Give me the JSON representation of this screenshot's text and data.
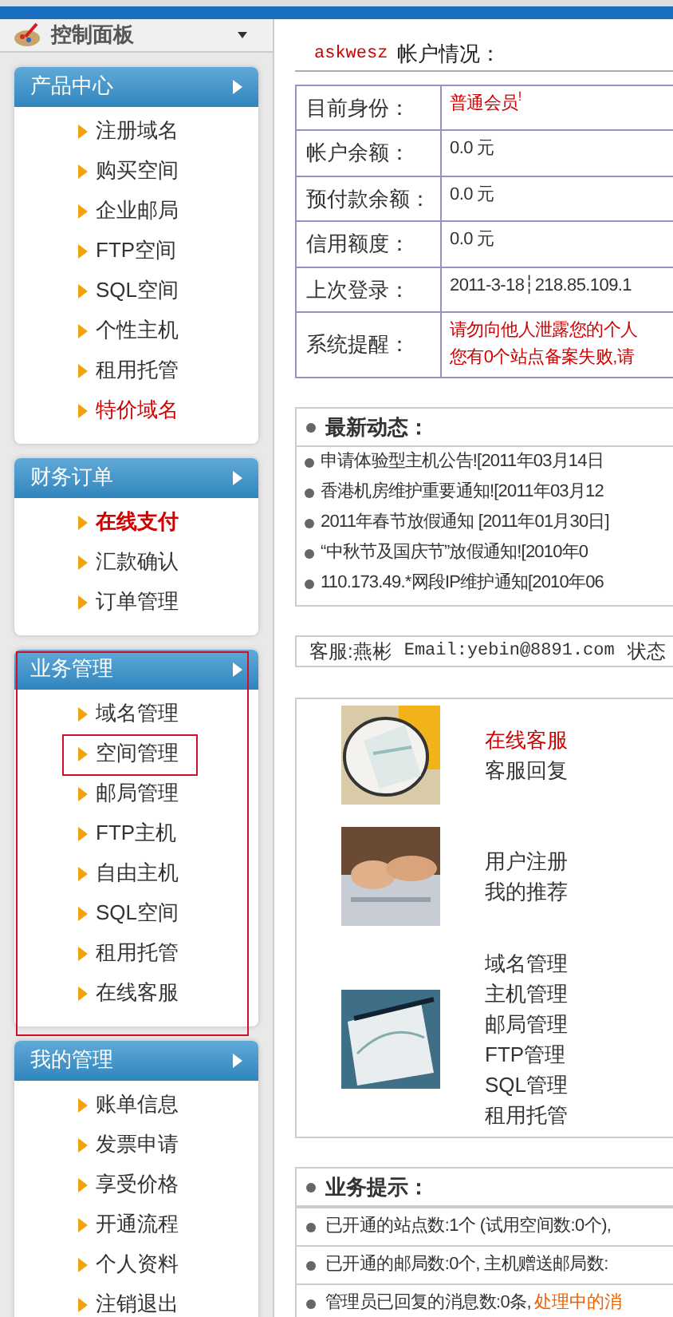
{
  "sidebar": {
    "title": "控制面板",
    "sections": [
      {
        "title": "产品中心",
        "highlighted": false,
        "items": [
          {
            "label": "注册域名",
            "red": false,
            "bold": false,
            "highlighted": false
          },
          {
            "label": "购买空间",
            "red": false,
            "bold": false,
            "highlighted": false
          },
          {
            "label": "企业邮局",
            "red": false,
            "bold": false,
            "highlighted": false
          },
          {
            "label": "FTP空间",
            "red": false,
            "bold": false,
            "highlighted": false
          },
          {
            "label": "SQL空间",
            "red": false,
            "bold": false,
            "highlighted": false
          },
          {
            "label": "个性主机",
            "red": false,
            "bold": false,
            "highlighted": false
          },
          {
            "label": "租用托管",
            "red": false,
            "bold": false,
            "highlighted": false
          },
          {
            "label": "特价域名",
            "red": true,
            "bold": false,
            "highlighted": false
          }
        ]
      },
      {
        "title": "财务订单",
        "highlighted": false,
        "items": [
          {
            "label": "在线支付",
            "red": true,
            "bold": true,
            "highlighted": false
          },
          {
            "label": "汇款确认",
            "red": false,
            "bold": false,
            "highlighted": false
          },
          {
            "label": "订单管理",
            "red": false,
            "bold": false,
            "highlighted": false
          }
        ]
      },
      {
        "title": "业务管理",
        "highlighted": true,
        "items": [
          {
            "label": "域名管理",
            "red": false,
            "bold": false,
            "highlighted": false
          },
          {
            "label": "空间管理",
            "red": false,
            "bold": false,
            "highlighted": true
          },
          {
            "label": "邮局管理",
            "red": false,
            "bold": false,
            "highlighted": false
          },
          {
            "label": "FTP主机",
            "red": false,
            "bold": false,
            "highlighted": false
          },
          {
            "label": "自由主机",
            "red": false,
            "bold": false,
            "highlighted": false
          },
          {
            "label": "SQL空间",
            "red": false,
            "bold": false,
            "highlighted": false
          },
          {
            "label": "租用托管",
            "red": false,
            "bold": false,
            "highlighted": false
          },
          {
            "label": "在线客服",
            "red": false,
            "bold": false,
            "highlighted": false
          }
        ]
      },
      {
        "title": "我的管理",
        "highlighted": false,
        "items": [
          {
            "label": "账单信息",
            "red": false,
            "bold": false,
            "highlighted": false
          },
          {
            "label": "发票申请",
            "red": false,
            "bold": false,
            "highlighted": false
          },
          {
            "label": "享受价格",
            "red": false,
            "bold": false,
            "highlighted": false
          },
          {
            "label": "开通流程",
            "red": false,
            "bold": false,
            "highlighted": false
          },
          {
            "label": "个人资料",
            "red": false,
            "bold": false,
            "highlighted": false
          },
          {
            "label": "注销退出",
            "red": false,
            "bold": false,
            "highlighted": false
          }
        ]
      }
    ]
  },
  "account": {
    "username": "askwesz",
    "heading": "帐户情况：",
    "rows": [
      {
        "label": "目前身份：",
        "values": [
          "普通会员$^{!}$"
        ],
        "red": true
      },
      {
        "label": "帐户余额：",
        "values": [
          "0.0 元"
        ],
        "red": false
      },
      {
        "label": "预付款余额：",
        "values": [
          "0.0 元"
        ],
        "red": false
      },
      {
        "label": "信用额度：",
        "values": [
          "0.0 元"
        ],
        "red": false
      },
      {
        "label": "上次登录：",
        "values": [
          "2011-3-18┆218.85.109.1"
        ],
        "red": false
      },
      {
        "label": "系统提醒：",
        "values": [
          "请勿向他人泄露您的个人",
          "您有0个站点备案失败,请"
        ],
        "red": true
      }
    ]
  },
  "news": {
    "title": "最新动态：",
    "items": [
      "申请体验型主机公告![2011年03月14日",
      "香港机房维护重要通知![2011年03月12",
      "2011年春节放假通知 [2011年01月30日]",
      "“中秋节及国庆节”放假通知![2010年0",
      "110.173.49.*网段IP维护通知[2010年06"
    ]
  },
  "service": {
    "staff": "客服:燕彬",
    "email": "Email:yebin@8891.com",
    "status": "状态"
  },
  "shortcuts": [
    {
      "kind": "picture",
      "links": [
        {
          "label": "在线客服",
          "red": true
        },
        {
          "label": "客服回复",
          "red": false
        }
      ]
    },
    {
      "kind": "picture",
      "links": [
        {
          "label": "用户注册",
          "red": false
        },
        {
          "label": "我的推荐",
          "red": false
        }
      ]
    },
    {
      "kind": "picture",
      "links": [
        {
          "label": "域名管理",
          "red": false
        },
        {
          "label": "主机管理",
          "red": false
        },
        {
          "label": "邮局管理",
          "red": false
        },
        {
          "label": "FTP管理",
          "red": false
        },
        {
          "label": "SQL管理",
          "red": false
        },
        {
          "label": "租用托管",
          "red": false
        }
      ]
    }
  ],
  "tips": {
    "title": "业务提示：",
    "items": [
      {
        "text": "已开通的站点数:1个 (试用空间数:0个),"
      },
      {
        "text": "已开通的邮局数:0个, 主机赠送邮局数:"
      },
      {
        "text": "管理员已回复的消息数:0条,",
        "link": "处理中的消"
      }
    ]
  }
}
